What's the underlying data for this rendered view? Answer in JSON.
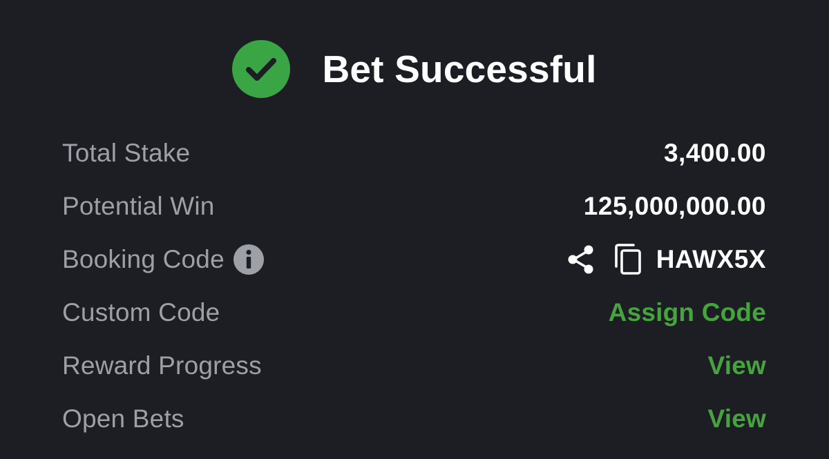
{
  "header": {
    "title": "Bet Successful",
    "icon": "check-circle-icon",
    "success_color": "#3aa544"
  },
  "rows": {
    "total_stake": {
      "label": "Total Stake",
      "value": "3,400.00"
    },
    "potential_win": {
      "label": "Potential Win",
      "value": "125,000,000.00"
    },
    "booking_code": {
      "label": "Booking Code",
      "info_icon": "info-icon",
      "share_icon": "share-icon",
      "copy_icon": "copy-icon",
      "value": "HAWX5X"
    },
    "custom_code": {
      "label": "Custom Code",
      "link": "Assign Code"
    },
    "reward_progress": {
      "label": "Reward Progress",
      "link": "View"
    },
    "open_bets": {
      "label": "Open Bets",
      "link": "View"
    }
  },
  "colors": {
    "background": "#1d1e23",
    "label": "#9ea0a8",
    "value": "#ffffff",
    "link": "#46a43f"
  }
}
